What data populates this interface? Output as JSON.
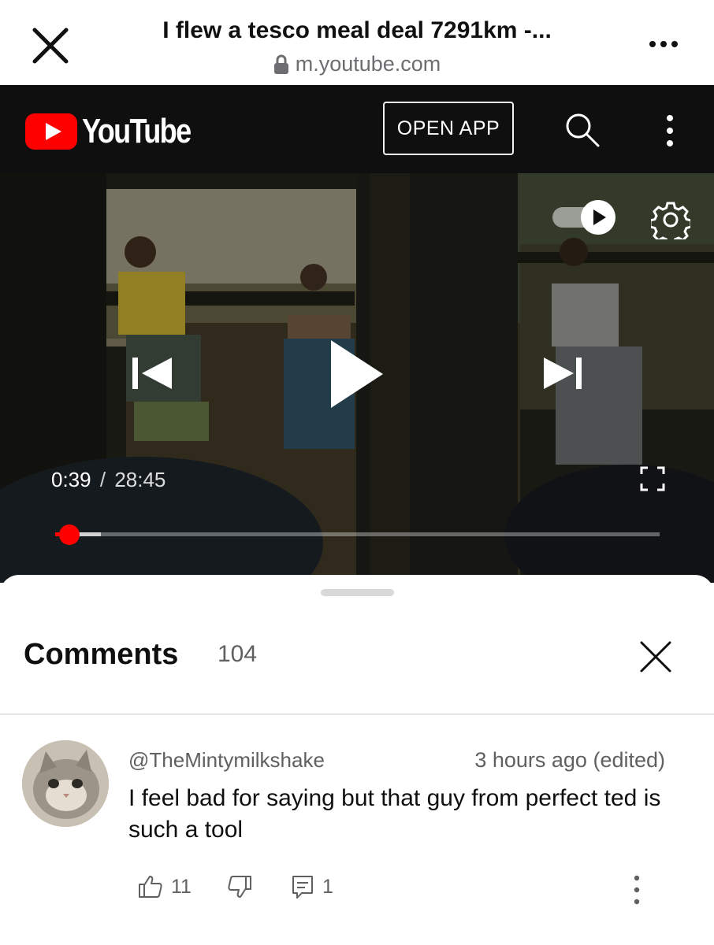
{
  "browser": {
    "title": "I flew a tesco meal deal 7291km -...",
    "url": "m.youtube.com"
  },
  "header": {
    "logo_text": "YouTube",
    "open_app_label": "OPEN APP",
    "brand_color": "#ff0000"
  },
  "player": {
    "current_time": "0:39",
    "separator": "/",
    "duration": "28:45",
    "progress_fraction": 0.023,
    "buffered_fraction": 0.075,
    "autoplay": "on",
    "icons": [
      "autoplay-toggle-icon",
      "settings-gear-icon",
      "previous-icon",
      "play-icon",
      "next-icon",
      "fullscreen-icon"
    ]
  },
  "comments": {
    "title": "Comments",
    "count": "104",
    "items": [
      {
        "author": "@TheMintymilkshake",
        "timestamp": "3 hours ago (edited)",
        "text": "I feel bad for saying but that guy from perfect ted is such a tool",
        "likes": "11",
        "replies": "1"
      }
    ]
  }
}
